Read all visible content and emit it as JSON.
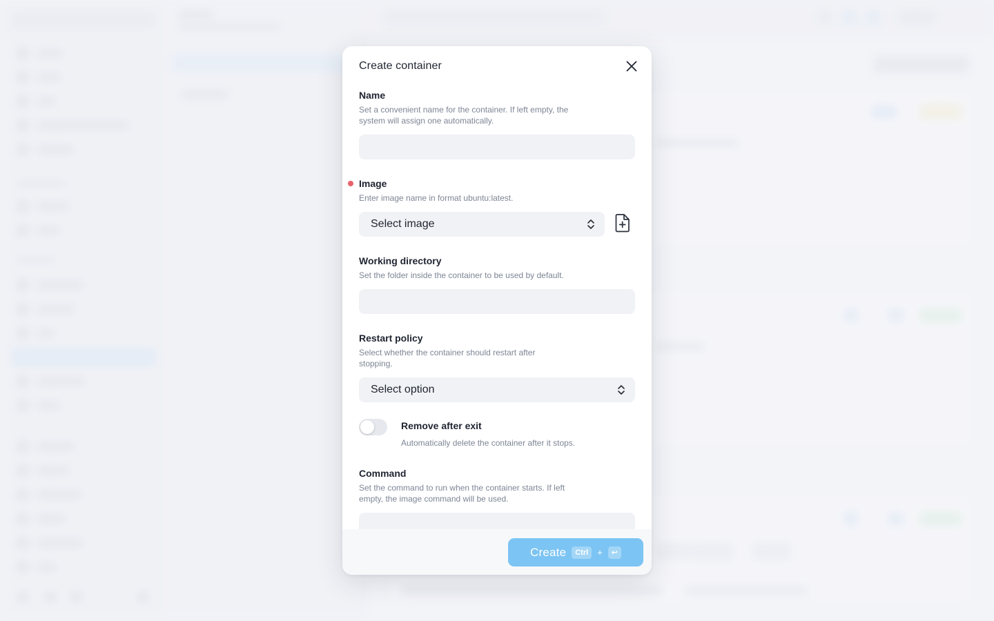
{
  "modal": {
    "title": "Create container",
    "fields": {
      "name": {
        "label": "Name",
        "description": "Set a convenient name for the container. If left empty, the system will assign one automatically.",
        "value": ""
      },
      "image": {
        "label": "Image",
        "required": true,
        "description": "Enter image name in format ubuntu:latest.",
        "selected": "Select image"
      },
      "working_directory": {
        "label": "Working directory",
        "description": "Set the folder inside the container to be used by default.",
        "value": ""
      },
      "restart_policy": {
        "label": "Restart policy",
        "description": "Select whether the container should restart after stopping.",
        "selected": "Select option"
      },
      "remove_after_exit": {
        "label": "Remove after exit",
        "description": "Automatically delete the container after it stops.",
        "enabled": false
      },
      "command": {
        "label": "Command",
        "description": "Set the command to run when the container starts. If left empty, the image command will be used.",
        "value": ""
      }
    },
    "footer": {
      "create_label": "Create",
      "shortcut_key": "Ctrl",
      "shortcut_plus": "+",
      "shortcut_enter": "↩"
    }
  },
  "colors": {
    "accent": "#7cc4f3",
    "required": "#e8616b",
    "input_bg": "#f1f2f5",
    "muted_text": "#7d8594"
  }
}
